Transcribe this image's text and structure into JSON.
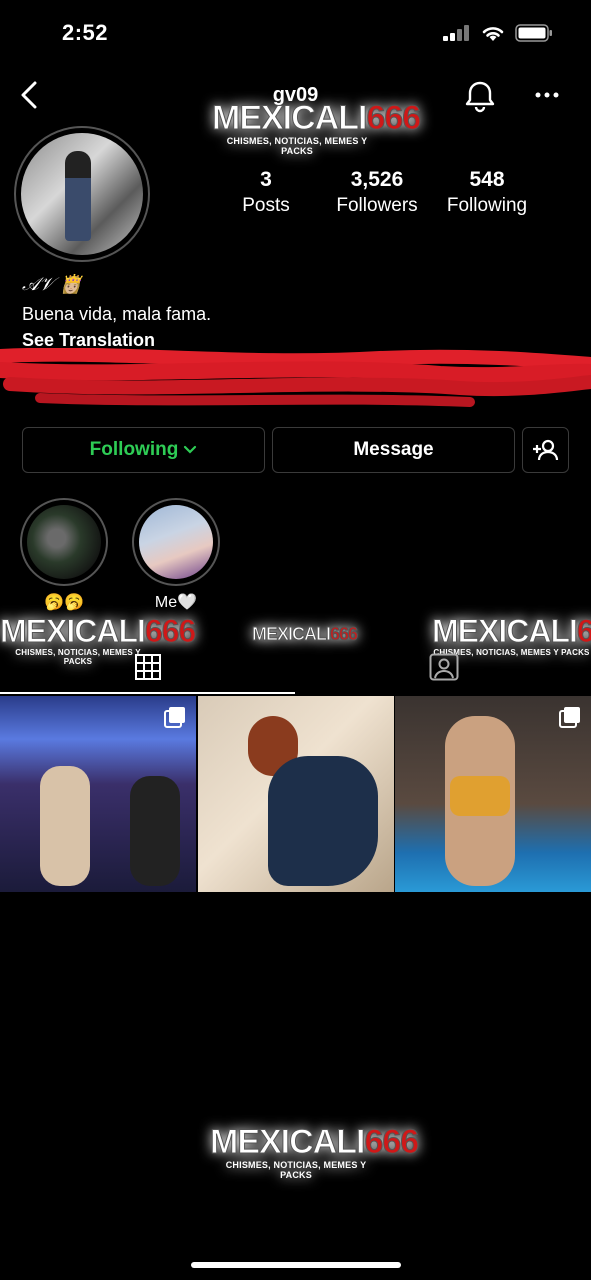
{
  "status_bar": {
    "time": "2:52"
  },
  "header": {
    "username": "gv09"
  },
  "stats": [
    {
      "value": "3",
      "label": "Posts"
    },
    {
      "value": "3,526",
      "label": "Followers"
    },
    {
      "value": "548",
      "label": "Following"
    }
  ],
  "bio": {
    "name": "𝒜𝒱 👸🏼",
    "text": "Buena vida, mala fama.",
    "see_translation": "See Translation"
  },
  "actions": {
    "following_label": "Following",
    "message_label": "Message"
  },
  "highlights": [
    {
      "caption": "🥱🥱"
    },
    {
      "caption": "Me🤍"
    }
  ],
  "watermark": {
    "brand_white": "MEXICALI",
    "brand_red": "666",
    "tagline": "CHISMES, NOTICIAS, MEMES Y PACKS"
  },
  "colors": {
    "following_green": "#2ecc55",
    "brand_red": "#d01818"
  },
  "icons": [
    "back-icon",
    "bell-icon",
    "more-icon",
    "chevron-down-icon",
    "add-user-icon",
    "grid-icon",
    "tagged-icon",
    "carousel-icon"
  ]
}
